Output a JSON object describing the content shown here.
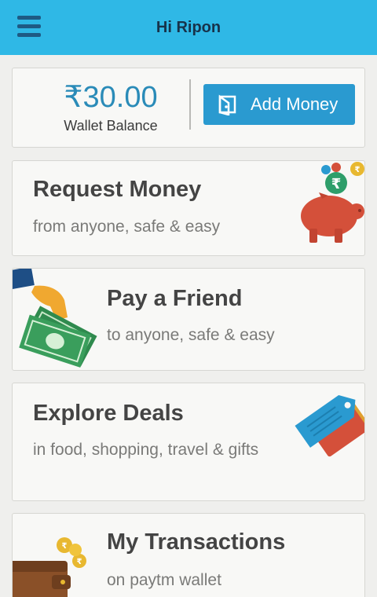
{
  "header": {
    "title": "Hi Ripon"
  },
  "wallet": {
    "balance": "₹30.00",
    "balance_label": "Wallet Balance",
    "add_money_label": "Add Money"
  },
  "cards": [
    {
      "title": "Request Money",
      "subtitle": "from anyone, safe & easy"
    },
    {
      "title": "Pay a Friend",
      "subtitle": "to anyone, safe & easy"
    },
    {
      "title": "Explore Deals",
      "subtitle": "in food, shopping, travel & gifts"
    },
    {
      "title": "My Transactions",
      "subtitle": "on paytm wallet"
    }
  ],
  "icons": {
    "menu": "hamburger-menu-icon",
    "wallet": "wallet-icon",
    "request": "piggy-bank-icon",
    "pay": "hand-with-money-icon",
    "deals": "price-tag-icon",
    "transactions": "wallet-with-coins-icon"
  },
  "colors": {
    "header": "#2fb8e6",
    "accent": "#2a9ad0",
    "balance": "#2a8bb8"
  }
}
